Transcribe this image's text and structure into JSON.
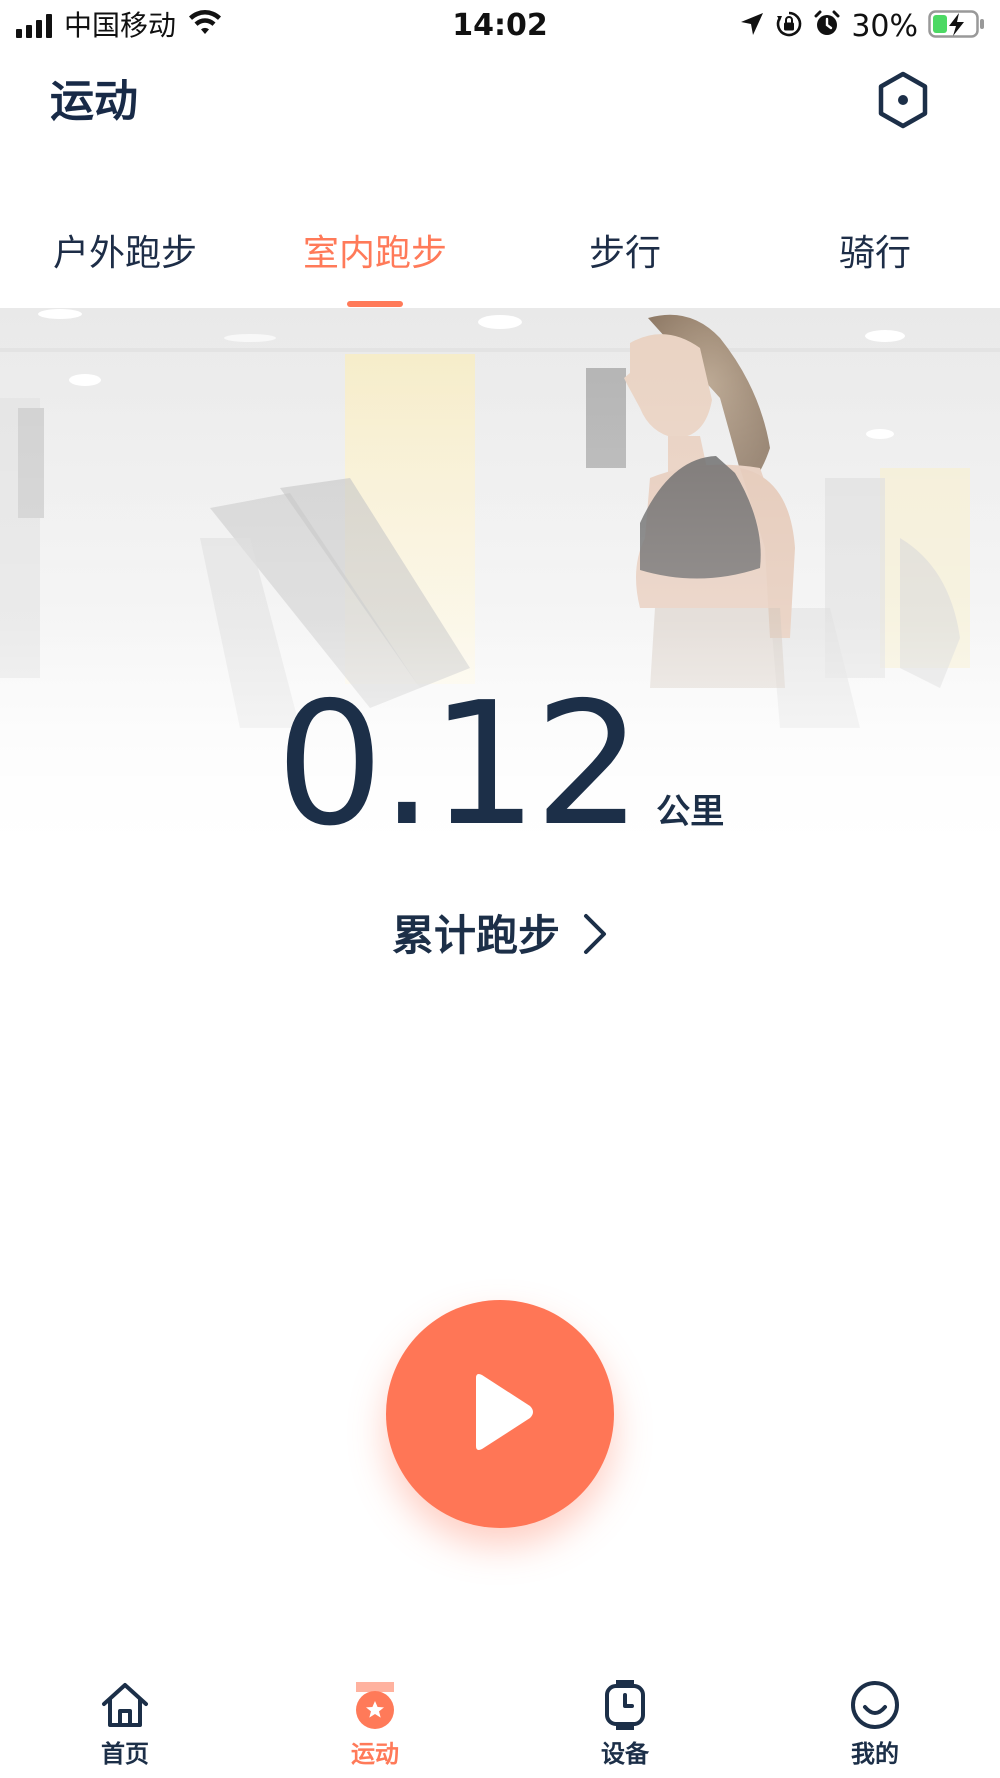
{
  "status_bar": {
    "carrier": "中国移动",
    "time": "14:02",
    "battery": "30%"
  },
  "header": {
    "title": "运动",
    "settings_icon": "hexagon-settings-icon"
  },
  "tabs": [
    {
      "label": "户外跑步",
      "active": false
    },
    {
      "label": "室内跑步",
      "active": true
    },
    {
      "label": "步行",
      "active": false
    },
    {
      "label": "骑行",
      "active": false
    }
  ],
  "hero": {
    "distance": "0.12",
    "unit": "公里",
    "total_link": "累计跑步"
  },
  "start_button": {
    "icon": "play-icon"
  },
  "bottom_nav": [
    {
      "label": "首页",
      "icon": "home-icon",
      "active": false
    },
    {
      "label": "运动",
      "icon": "sport-icon",
      "active": true
    },
    {
      "label": "设备",
      "icon": "watch-icon",
      "active": false
    },
    {
      "label": "我的",
      "icon": "smile-icon",
      "active": false
    }
  ],
  "colors": {
    "accent": "#ff7a59",
    "text_dark": "#1c2f48",
    "battery_green": "#4cd964"
  }
}
